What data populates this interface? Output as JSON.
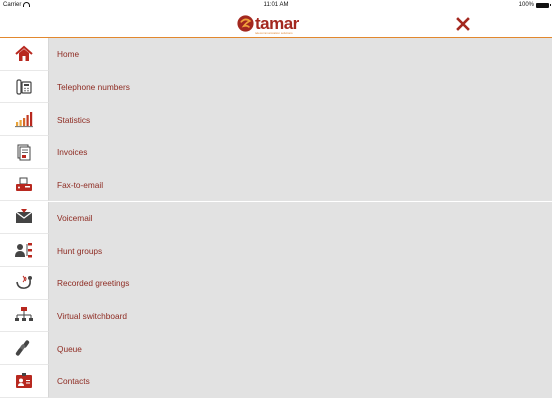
{
  "status_bar": {
    "carrier": "Carrier",
    "time": "11:01 AM",
    "battery": "100%"
  },
  "header": {
    "logo_text": "tamar",
    "logo_tagline": "telecommunication solutions",
    "close_icon": "close-x-icon"
  },
  "colors": {
    "brand_red": "#a3281f",
    "accent_orange": "#e2882e",
    "label_text": "#8e2b22",
    "menu_background": "#e2e2e2"
  },
  "menu": {
    "items": [
      {
        "label": "Home",
        "icon": "home-icon"
      },
      {
        "label": "Telephone numbers",
        "icon": "telephone-icon"
      },
      {
        "label": "Statistics",
        "icon": "statistics-icon"
      },
      {
        "label": "Invoices",
        "icon": "invoice-icon"
      },
      {
        "label": "Fax-to-email",
        "icon": "fax-icon"
      },
      {
        "label": "Voicemail",
        "icon": "voicemail-icon"
      },
      {
        "label": "Hunt groups",
        "icon": "hunt-group-icon"
      },
      {
        "label": "Recorded greetings",
        "icon": "recorded-greeting-icon"
      },
      {
        "label": "Virtual switchboard",
        "icon": "switchboard-icon"
      },
      {
        "label": "Queue",
        "icon": "queue-icon"
      },
      {
        "label": "Contacts",
        "icon": "contacts-icon"
      }
    ]
  }
}
